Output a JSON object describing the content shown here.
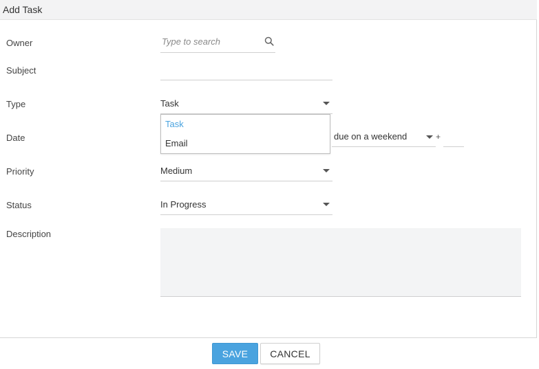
{
  "dialog": {
    "title": "Add Task"
  },
  "fields": {
    "owner": {
      "label": "Owner",
      "placeholder": "Type to search"
    },
    "subject": {
      "label": "Subject",
      "value": ""
    },
    "type": {
      "label": "Type",
      "value": "Task"
    },
    "date": {
      "label": "Date",
      "rule_value": "due on a weekend",
      "plus": "+"
    },
    "priority": {
      "label": "Priority",
      "value": "Medium"
    },
    "status": {
      "label": "Status",
      "value": "In Progress"
    },
    "description": {
      "label": "Description",
      "value": ""
    }
  },
  "type_dropdown": {
    "options": [
      {
        "label": "Task",
        "selected": true
      },
      {
        "label": "Email",
        "selected": false
      }
    ]
  },
  "footer": {
    "save_label": "SAVE",
    "cancel_label": "CANCEL"
  },
  "colors": {
    "accent": "#4aa3df",
    "selected_option": "#4aa3df",
    "header_bg": "#f3f3f4",
    "description_bg": "#f3f4f5"
  },
  "icons": {
    "owner_search": "search-icon",
    "select_caret": "caret-down-icon"
  }
}
